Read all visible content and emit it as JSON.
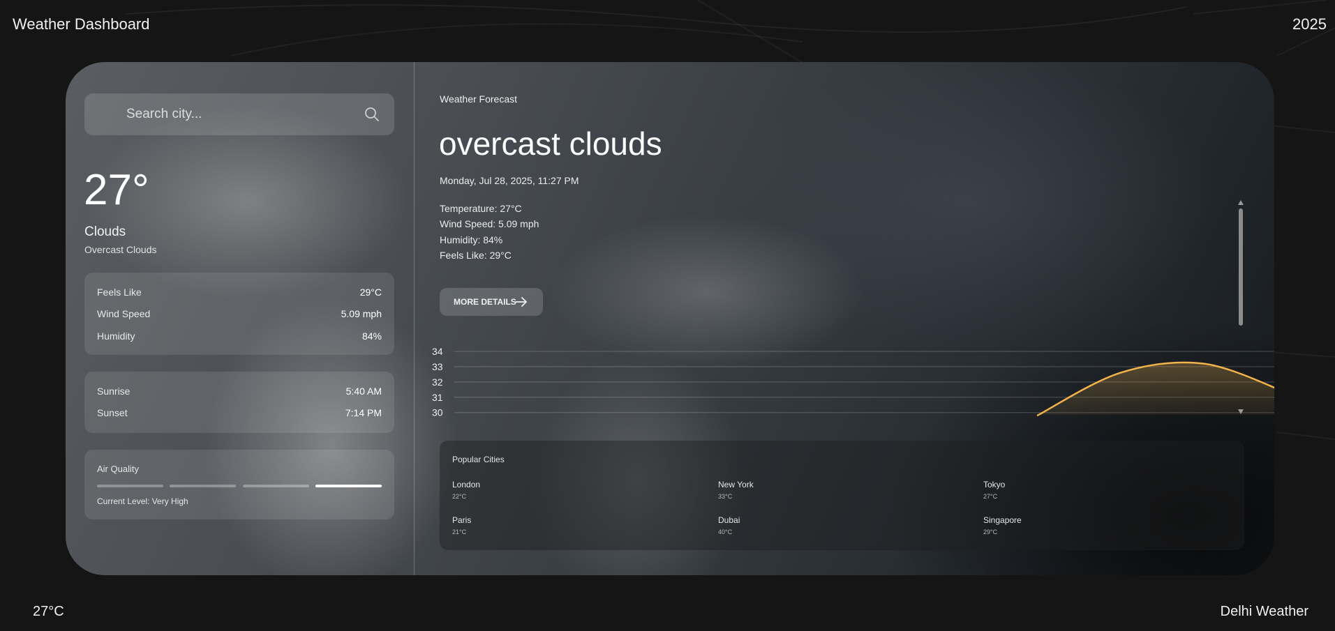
{
  "header": {
    "title": "Weather Dashboard",
    "year": "2025"
  },
  "footer": {
    "temperature": "27°C",
    "location": "Delhi Weather"
  },
  "search": {
    "placeholder": "Search city...",
    "value": ""
  },
  "current": {
    "temp": "27°",
    "condition": "Clouds",
    "description": "Overcast Clouds"
  },
  "stats": [
    {
      "label": "Feels Like",
      "value": "29°C"
    },
    {
      "label": "Wind Speed",
      "value": "5.09 mph"
    },
    {
      "label": "Humidity",
      "value": "84%"
    }
  ],
  "sun": [
    {
      "label": "Sunrise",
      "value": "5:40 AM"
    },
    {
      "label": "Sunset",
      "value": "7:14 PM"
    }
  ],
  "air_quality": {
    "title": "Air Quality",
    "level_text": "Current Level: Very High",
    "level_index": 4,
    "levels_total": 4
  },
  "forecast": {
    "label": "Weather Forecast",
    "headline": "overcast clouds",
    "datetime": "Monday, Jul 28, 2025, 11:27 PM",
    "details": [
      "Temperature: 27°C",
      "Wind Speed: 5.09 mph",
      "Humidity: 84%",
      "Feels Like: 29°C"
    ],
    "button_label": "MORE DETAILS"
  },
  "chart_data": {
    "type": "area",
    "yticks": [
      34,
      33,
      32,
      31,
      30
    ],
    "ylim": [
      29.85,
      34
    ],
    "x": [
      0,
      1,
      2,
      3,
      4,
      5,
      6,
      7,
      8,
      9,
      10
    ],
    "series": [
      {
        "values": [
          null,
          null,
          null,
          null,
          null,
          null,
          null,
          29.8,
          32.6,
          33.2,
          31.3
        ]
      }
    ],
    "line_color": "#f2b44a",
    "grid": true
  },
  "popular_cities": {
    "title": "Popular Cities",
    "cities": [
      {
        "name": "London",
        "temp": "22°C"
      },
      {
        "name": "New York",
        "temp": "33°C"
      },
      {
        "name": "Tokyo",
        "temp": "27°C"
      },
      {
        "name": "Paris",
        "temp": "21°C"
      },
      {
        "name": "Dubai",
        "temp": "40°C"
      },
      {
        "name": "Singapore",
        "temp": "29°C"
      }
    ]
  }
}
